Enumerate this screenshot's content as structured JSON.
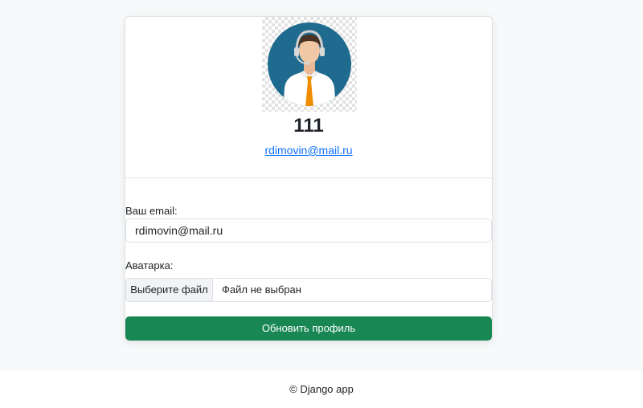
{
  "profile": {
    "avatar_icon": "support-agent-avatar",
    "username": "111",
    "email_link": "rdimovin@mail.ru"
  },
  "form": {
    "email_label": "Ваш email:",
    "email_value": "rdimovin@mail.ru",
    "avatar_label": "Аватарка:",
    "file_button_label": "Выберите файл",
    "file_status": "Файл не выбран",
    "submit_label": "Обновить профиль"
  },
  "footer": {
    "text": "© Django app"
  },
  "colors": {
    "accent": "#198754",
    "link": "#0d6efd",
    "avatar_bg": "#1e6b8f",
    "tie": "#f08c00"
  }
}
